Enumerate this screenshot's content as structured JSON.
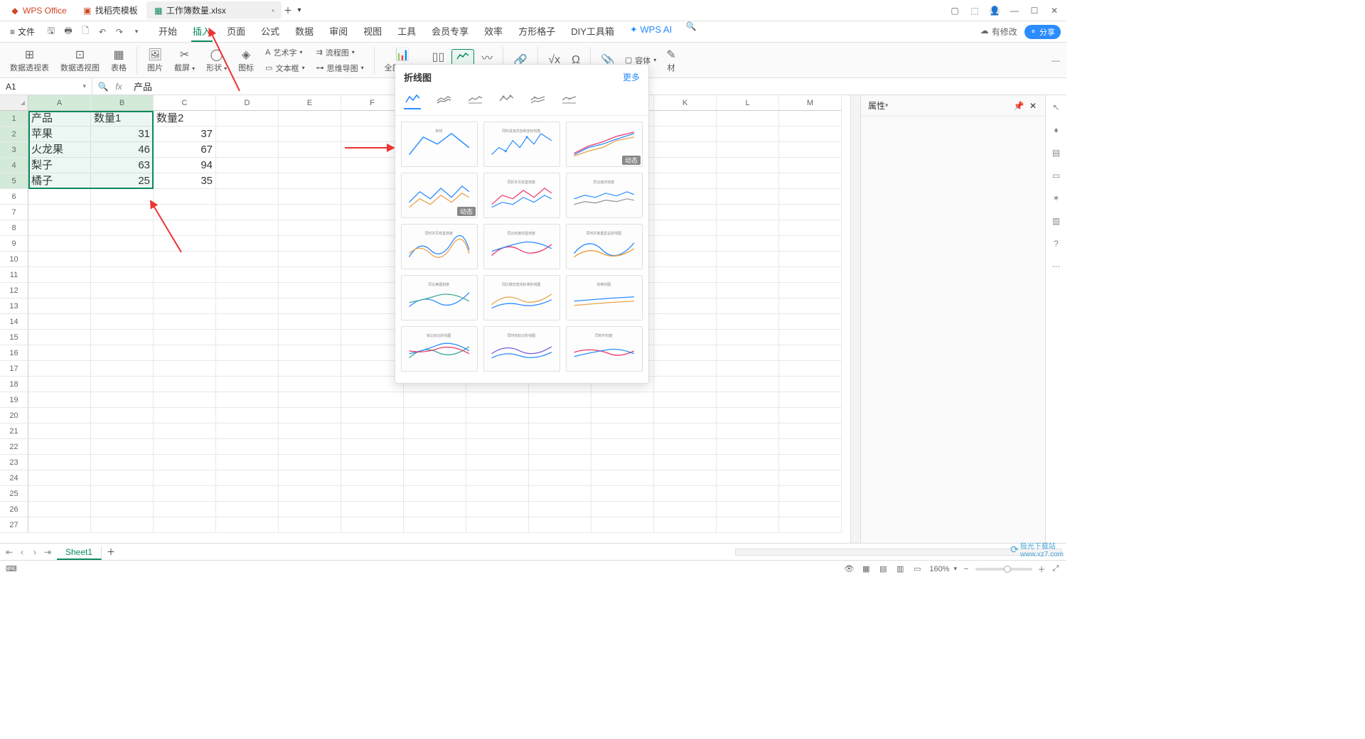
{
  "title_bar": {
    "tabs": [
      {
        "label": "WPS Office",
        "cls": "wps"
      },
      {
        "label": "找稻壳模板",
        "cls": "docer"
      },
      {
        "label": "工作簿数量.xlsx",
        "cls": "sheet"
      }
    ],
    "modified_dot": "•"
  },
  "menu": {
    "file": "文件",
    "tabs": [
      "开始",
      "插入",
      "页面",
      "公式",
      "数据",
      "审阅",
      "视图",
      "工具",
      "会员专享",
      "效率",
      "方形格子",
      "DIY工具箱",
      "WPS AI"
    ],
    "active_tab": "插入",
    "changes": "有修改",
    "share": "分享"
  },
  "ribbon": {
    "groups": [
      {
        "label": "数据透视表",
        "icon": "pivot"
      },
      {
        "label": "数据透视图",
        "icon": "pivotchart"
      },
      {
        "label": "表格",
        "icon": "table"
      },
      {
        "label": "图片",
        "icon": "image"
      },
      {
        "label": "截屏",
        "icon": "screenshot",
        "dd": true
      },
      {
        "label": "形状",
        "icon": "shapes",
        "dd": true
      },
      {
        "label": "图标",
        "icon": "icons"
      }
    ],
    "mid": {
      "art": "艺术字",
      "textbox": "文本框",
      "flowchart": "流程图",
      "mindmap": "思维导图"
    },
    "charts": "全部图表",
    "container": "容体",
    "material": "材"
  },
  "fx": {
    "ref": "A1",
    "content": "产品"
  },
  "sheet": {
    "columns": [
      "A",
      "B",
      "C",
      "D",
      "E",
      "F",
      "G",
      "H",
      "I",
      "J",
      "K",
      "L",
      "M"
    ],
    "rows": [
      "1",
      "2",
      "3",
      "4",
      "5",
      "6",
      "7",
      "8",
      "9",
      "10",
      "11",
      "12",
      "13",
      "14",
      "15",
      "16",
      "17",
      "18",
      "19",
      "20",
      "21",
      "22",
      "23",
      "24",
      "25",
      "26",
      "27"
    ],
    "selected_cols": [
      "A",
      "B"
    ],
    "selected_rows": [
      "1",
      "2",
      "3",
      "4",
      "5"
    ]
  },
  "chart_data": {
    "type": "table",
    "title": "sheet-data",
    "headers": [
      "产品",
      "数量1",
      "数量2"
    ],
    "rows": [
      [
        "苹果",
        31,
        37
      ],
      [
        "火龙果",
        46,
        67
      ],
      [
        "梨子",
        63,
        94
      ],
      [
        "橘子",
        25,
        35
      ]
    ]
  },
  "popup": {
    "title": "折线图",
    "more": "更多",
    "dynamic_badge": "动态",
    "thumb_titles": [
      "单线",
      "同时具有内容和坐标刻度",
      "",
      "",
      "同折并见有直刻度",
      "同比度的刻度",
      "同时并见有直刻度",
      "同比有度的直刻度",
      "同时并度量型设折线图",
      "同比美图刻度",
      "同比模仿直线标准折线图",
      "有倒的图",
      "有比标记折线图",
      "同时有标记折线图",
      "同时件刻度"
    ]
  },
  "prop": {
    "label": "属性"
  },
  "sheet_tabs": {
    "active": "Sheet1"
  },
  "status": {
    "zoom": "160%"
  },
  "watermark": "极光下载站\nwww.xz7.com"
}
